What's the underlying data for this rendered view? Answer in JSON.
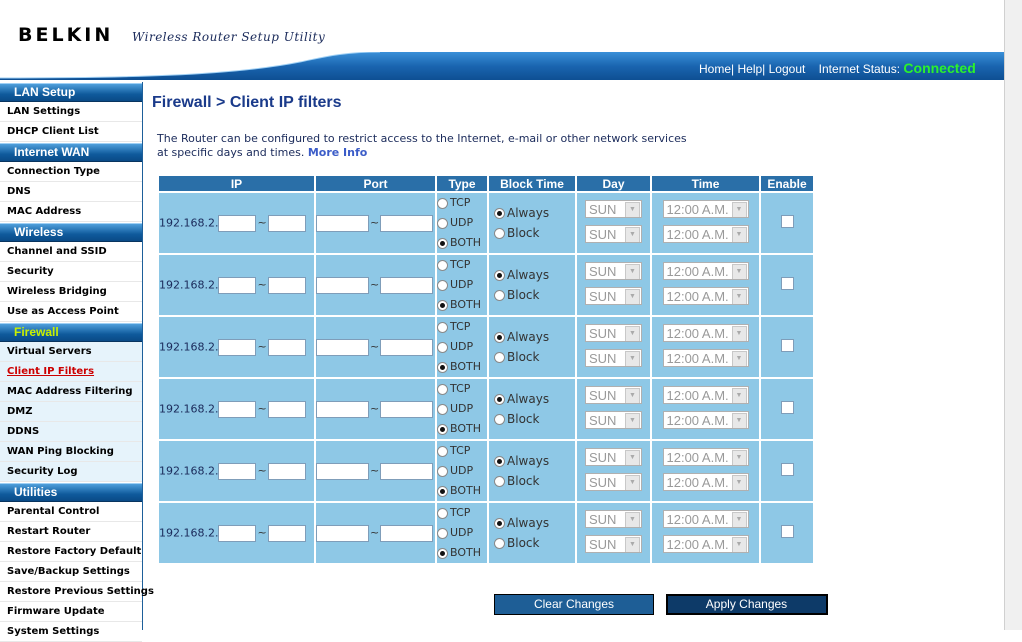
{
  "header": {
    "brand": "BELKIN",
    "tagline": "Wireless Router Setup Utility",
    "links": {
      "home": "Home|",
      "help": "Help|",
      "logout": "Logout"
    },
    "status_label": "Internet Status:",
    "status_value": "Connected"
  },
  "colors": {
    "accent": "#1d5f9a",
    "table_header": "#2a6fa8",
    "row_bg": "#8ec8e6",
    "status_connected": "#2bf22b",
    "active_link": "#cc0000"
  },
  "sidebar": {
    "sections": [
      {
        "title": "LAN Setup",
        "items": [
          "LAN Settings",
          "DHCP Client List"
        ]
      },
      {
        "title": "Internet WAN",
        "items": [
          "Connection Type",
          "DNS",
          "MAC Address"
        ]
      },
      {
        "title": "Wireless",
        "items": [
          "Channel and SSID",
          "Security",
          "Wireless Bridging",
          "Use as Access Point"
        ]
      },
      {
        "title": "Firewall",
        "items": [
          "Virtual Servers",
          "Client IP Filters",
          "MAC Address Filtering",
          "DMZ",
          "DDNS",
          "WAN Ping Blocking",
          "Security Log"
        ]
      },
      {
        "title": "Utilities",
        "items": [
          "Parental Control",
          "Restart Router",
          "Restore Factory Default",
          "Save/Backup Settings",
          "Restore Previous Settings",
          "Firmware Update",
          "System Settings"
        ]
      }
    ],
    "current_item": "Client IP Filters"
  },
  "main": {
    "title": "Firewall > Client IP filters",
    "intro_line1": "The Router can be configured to restrict access to the Internet, e-mail or other network services",
    "intro_line2": "at specific days and times.",
    "more_info": "More Info"
  },
  "table": {
    "headers": {
      "ip": "IP",
      "port": "Port",
      "type": "Type",
      "block_time": "Block Time",
      "day": "Day",
      "time": "Time",
      "enable": "Enable"
    },
    "ip_prefix": "192.168.2.",
    "tilde": "~",
    "type_options": [
      "TCP",
      "UDP",
      "BOTH"
    ],
    "block_options": [
      "Always",
      "Block"
    ],
    "day_value": "SUN",
    "time_value": "12:00 A.M.",
    "rows": [
      {
        "type": "BOTH",
        "block": "Always",
        "enabled": false
      },
      {
        "type": "BOTH",
        "block": "Always",
        "enabled": false
      },
      {
        "type": "BOTH",
        "block": "Always",
        "enabled": false
      },
      {
        "type": "BOTH",
        "block": "Always",
        "enabled": false
      },
      {
        "type": "BOTH",
        "block": "Always",
        "enabled": false
      },
      {
        "type": "BOTH",
        "block": "Always",
        "enabled": false
      }
    ]
  },
  "buttons": {
    "clear": "Clear Changes",
    "apply": "Apply Changes"
  }
}
